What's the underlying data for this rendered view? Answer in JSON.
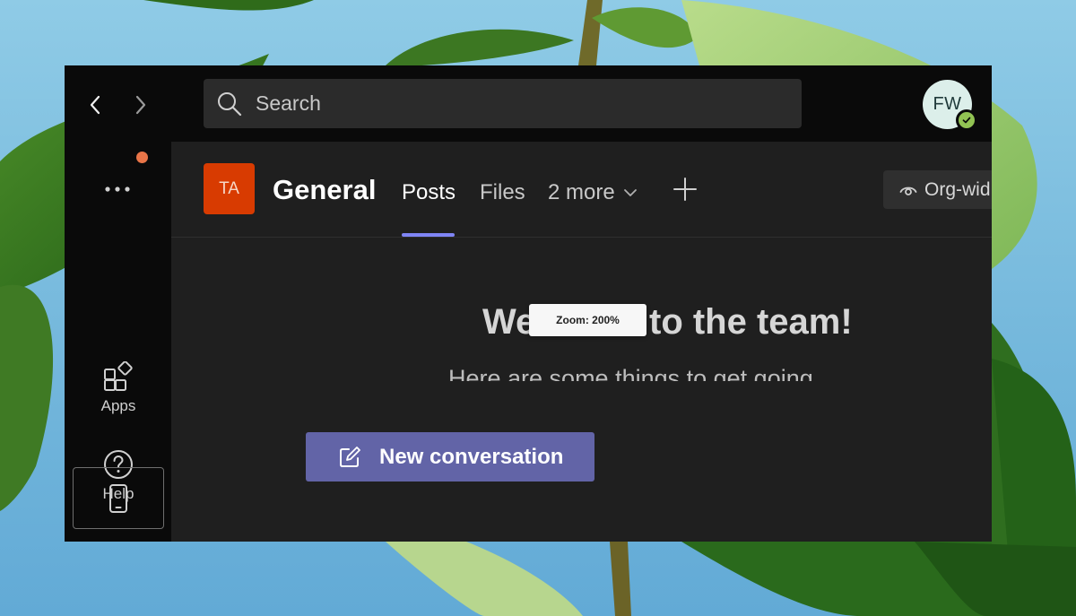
{
  "search": {
    "placeholder": "Search"
  },
  "profile": {
    "initials": "FW",
    "status": "available"
  },
  "rail": {
    "more_label": "...",
    "items": [
      {
        "label": "Apps"
      },
      {
        "label": "Help"
      }
    ]
  },
  "channel": {
    "team_initials": "TA",
    "name": "General",
    "tabs": [
      {
        "label": "Posts"
      },
      {
        "label": "Files"
      },
      {
        "label": "2 more"
      }
    ],
    "org_button": "Org-wid"
  },
  "content": {
    "welcome": "Welcome to the team!",
    "subtitle": "Here are some things to get going",
    "new_conversation": "New conversation"
  },
  "zoom_tooltip": "Zoom: 200%",
  "colors": {
    "accent": "#6264a7",
    "tab_underline": "#7f85f5",
    "team_tile": "#d83b01",
    "notification_dot": "#e97548",
    "presence_available": "#92c353"
  },
  "icons": [
    "back-arrow-icon",
    "forward-arrow-icon",
    "search-icon",
    "more-icon",
    "apps-icon",
    "help-icon",
    "mobile-icon",
    "chevron-down-icon",
    "plus-icon",
    "eye-icon",
    "compose-icon",
    "checkmark-icon"
  ]
}
